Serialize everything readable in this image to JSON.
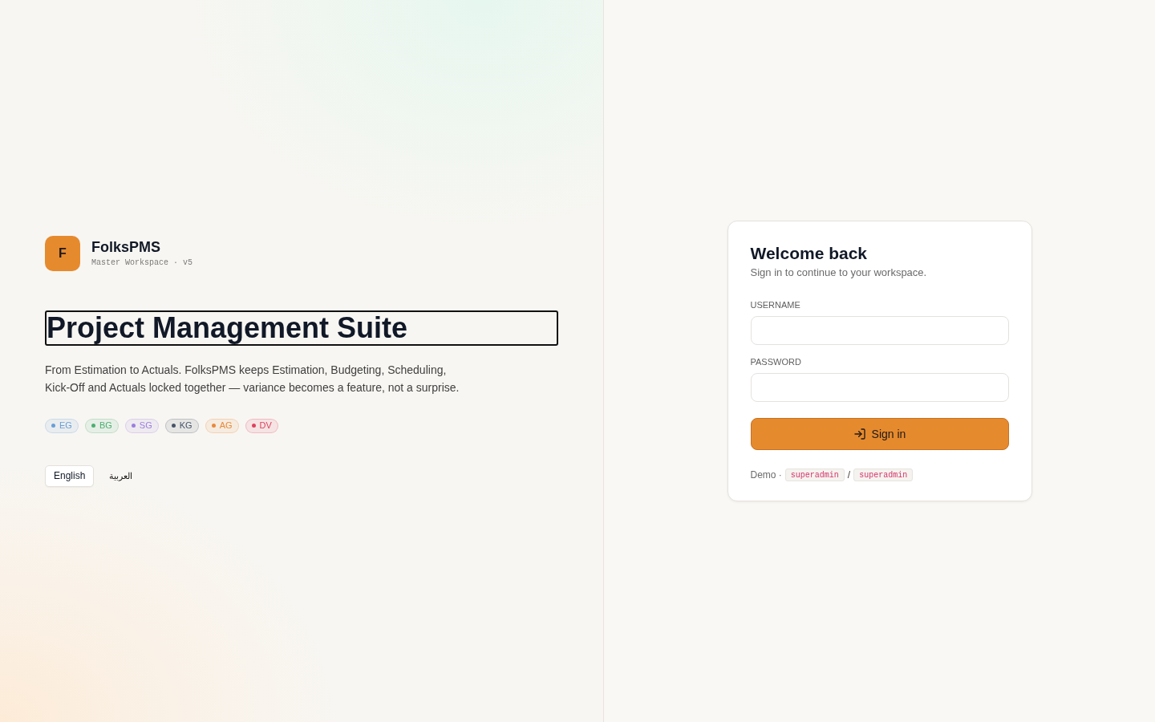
{
  "brand": {
    "logo_letter": "F",
    "name": "FolksPMS",
    "subtitle": "Master Workspace · v5"
  },
  "hero": {
    "heading": "Project Management Suite",
    "focused": true,
    "description": "From Estimation to Actuals. FolksPMS keeps Estimation, Budgeting, Scheduling, Kick-Off and Actuals locked together — variance becomes a feature, not a surprise."
  },
  "tags": [
    {
      "label": "EG",
      "color": "#6a9ed8"
    },
    {
      "label": "BG",
      "color": "#4caf72"
    },
    {
      "label": "SG",
      "color": "#9b7fe0"
    },
    {
      "label": "KG",
      "color": "#475569"
    },
    {
      "label": "AG",
      "color": "#e8893a"
    },
    {
      "label": "DV",
      "color": "#e0405e"
    }
  ],
  "languages": [
    {
      "label": "English",
      "selected": true
    },
    {
      "label": "العربية",
      "selected": false
    }
  ],
  "login": {
    "title": "Welcome back",
    "subtitle": "Sign in to continue to your workspace.",
    "fields": [
      {
        "label": "USERNAME"
      },
      {
        "label": "PASSWORD"
      }
    ],
    "submit": "Sign in",
    "demo": {
      "label": "Demo ·",
      "username": "superadmin",
      "separator": "/",
      "password": "superadmin"
    }
  }
}
